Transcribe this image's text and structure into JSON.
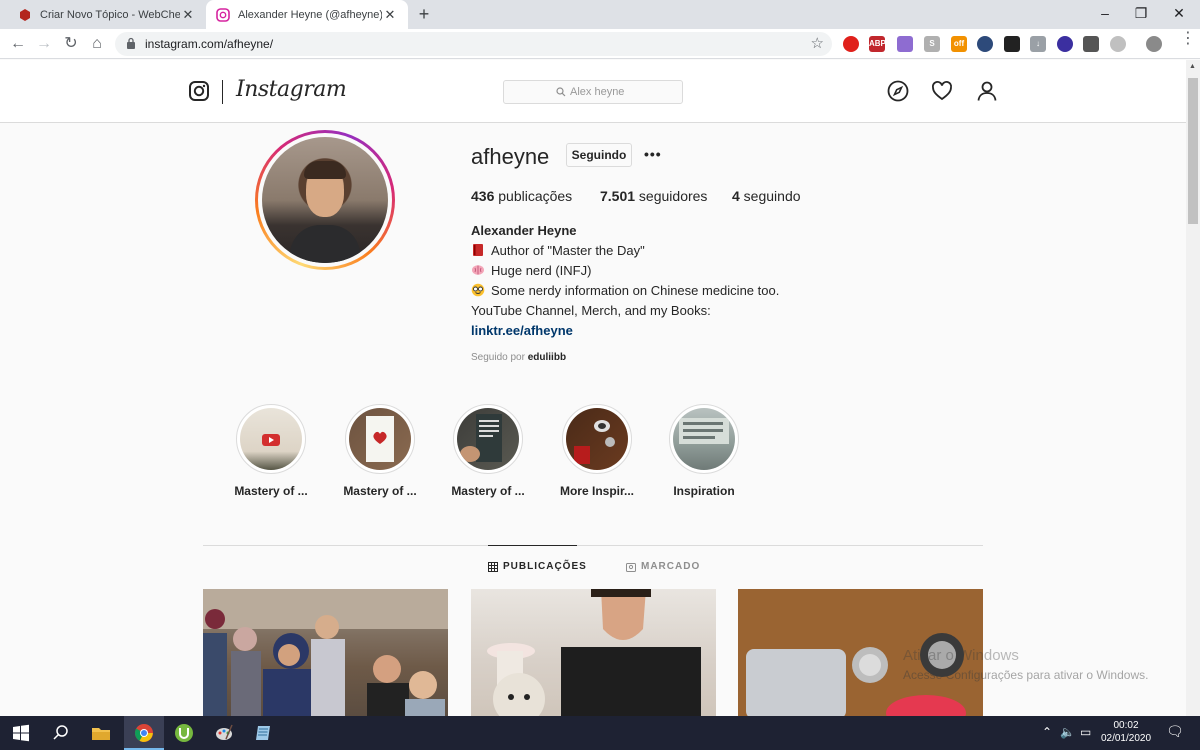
{
  "browser": {
    "tabs": [
      {
        "title": "Criar Novo Tópico - WebCheats",
        "active": false
      },
      {
        "title": "Alexander Heyne (@afheyne) • Fotos",
        "active": true
      }
    ],
    "new_tab_symbol": "+",
    "url": "instagram.com/afheyne/"
  },
  "instagram": {
    "wordmark": "Instagram",
    "search_placeholder": "Alex heyne",
    "nav_icons": [
      "explore-icon",
      "activity-heart-icon",
      "profile-icon"
    ]
  },
  "profile": {
    "username": "afheyne",
    "follow_button": "Seguindo",
    "more_button": "•••",
    "stats": [
      {
        "value": "436",
        "label": " publicações"
      },
      {
        "value": "7.501",
        "label": " seguidores"
      },
      {
        "value": "4",
        "label": " seguindo"
      }
    ],
    "bio_name": "Alexander Heyne",
    "bio_lines": [
      {
        "emoji": "book-icon",
        "text": "Author of \"Master the Day\""
      },
      {
        "emoji": "brain-icon",
        "text": "Huge nerd (INFJ)"
      },
      {
        "emoji": "nerd-face-icon",
        "text": "Some nerdy information on Chinese medicine too."
      },
      {
        "emoji": "",
        "text": "YouTube Channel, Merch, and my Books:"
      }
    ],
    "bio_link": "linktr.ee/afheyne",
    "followed_by_prefix": "Seguido por ",
    "followed_by_user": "eduliibb"
  },
  "highlights": [
    {
      "label": "Mastery of ..."
    },
    {
      "label": "Mastery of ..."
    },
    {
      "label": "Mastery of ..."
    },
    {
      "label": "More Inspir..."
    },
    {
      "label": "Inspiration"
    }
  ],
  "profile_tabs": [
    {
      "label": "PUBLICAÇÕES",
      "active": true
    },
    {
      "label": "MARCADO",
      "active": false
    }
  ],
  "windows_watermark": {
    "line1": "Ativar o Windows",
    "line2": "Acesse Configurações para ativar o Windows."
  },
  "taskbar": {
    "time": "00:02",
    "date": "02/01/2020"
  },
  "colors": {
    "ig_link": "#00376b",
    "ig_border": "#dbdbdb",
    "taskbar": "#1e2233"
  }
}
